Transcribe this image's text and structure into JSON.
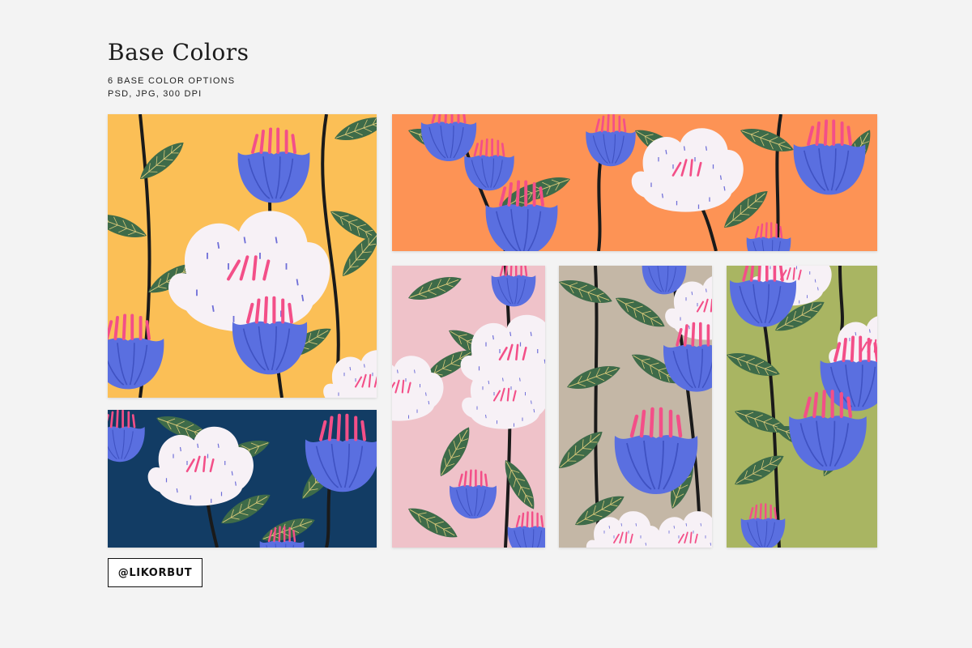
{
  "header": {
    "title": "Base Colors",
    "subtitle_line1": "6 BASE COLOR OPTIONS",
    "subtitle_line2": "PSD, JPG, 300 DPI"
  },
  "badge": {
    "label": "@LIKORBUT"
  },
  "swatches": {
    "yellow": "#fbbf56",
    "orange": "#fd9355",
    "navy": "#123c64",
    "pink": "#efc2c9",
    "taupe": "#c4b7a6",
    "olive": "#a9b562"
  },
  "motif_colors": {
    "blue_flower": "#5a6fe0",
    "white_flower": "#f7f1f6",
    "stamen": "#f34f88",
    "leaf": "#3e6b49",
    "stem": "#1a1a1a"
  }
}
